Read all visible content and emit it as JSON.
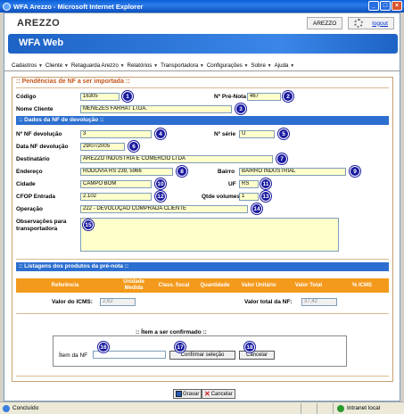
{
  "window": {
    "title": "WFA Arezzo - Microsoft Internet Explorer"
  },
  "header": {
    "brand": "AREZZO",
    "user_box": "AREZZO",
    "logout": "logout"
  },
  "banner": {
    "title": "WFA Web"
  },
  "menu": [
    "Cadastros",
    "Cliente",
    "Retaguarda Arezzo",
    "Relatórios",
    "Transportadora",
    "Configurações",
    "Sobre",
    "Ajuda"
  ],
  "panel": {
    "title": ":: Pendências de NF a ser importada ::",
    "codigo": {
      "label": "Código",
      "value": "16305"
    },
    "pre_nota": {
      "label": "Nº Pré-Nota",
      "value": "467"
    },
    "nome_cliente": {
      "label": "Nome Cliente",
      "value": "MENEZES FARHAT LTDA."
    },
    "section_devolucao": ":: Dados da NF de devolução ::",
    "nf_devolucao": {
      "label": "Nº NF devolução",
      "value": "3"
    },
    "serie": {
      "label": "Nº série",
      "value": "U"
    },
    "data_nf": {
      "label": "Data NF devolução",
      "value": "29/07/2005"
    },
    "destinatario": {
      "label": "Destinatário",
      "value": "AREZZO INDUSTRIA E COMÉRCIO LTDA"
    },
    "endereco": {
      "label": "Endereço",
      "value": "RODOVIA RS 239, 5966"
    },
    "bairro": {
      "label": "Bairro",
      "value": "BAIRRO INDUSTRIAL"
    },
    "cidade": {
      "label": "Cidade",
      "value": "CAMPO BOM"
    },
    "uf": {
      "label": "UF",
      "value": "RS"
    },
    "cfop": {
      "label": "CFOP Entrada",
      "value": "2.102"
    },
    "volumes": {
      "label": "Qtde volumes",
      "value": "1"
    },
    "operacao": {
      "label": "Operação",
      "value": "222 - DEVOLUÇÃO COMPRADA CLIENTE"
    },
    "observacoes": {
      "label_line1": "Observações para",
      "label_line2": "transportadora",
      "value": ""
    },
    "section_produtos": ":: Listagens dos produtos da pré-nota ::",
    "grid_columns": [
      "Referência",
      "Unidade Medida",
      "Class. fiscal",
      "Quantidade",
      "Valor Unitário",
      "Valor Total",
      "% ICMS"
    ],
    "valor_icms": {
      "label": "Valor do ICMS:",
      "value": "2,62"
    },
    "valor_total_nf": {
      "label": "Valor total da NF:",
      "value": "37,42"
    },
    "confirm": {
      "title": ":: Ítem a ser confirmado ::",
      "item_label": "Ítem da NF",
      "item_value": "",
      "confirm_button": "Confirmar seleção",
      "cancel_button": "Cancelar"
    },
    "save_button": "Gravar",
    "cancel_button": "Cancelar"
  },
  "badges": [
    "1",
    "2",
    "3",
    "4",
    "5",
    "6",
    "7",
    "8",
    "9",
    "10",
    "11",
    "12",
    "13",
    "14",
    "15",
    "16",
    "17",
    "18"
  ],
  "status": {
    "left": "Concluído",
    "zone": "Intranet local"
  },
  "colors": {
    "accent_blue": "#2d6fd0",
    "grid_orange": "#f39a1c",
    "field_yellow": "#ffffcc",
    "title_orange": "#c4561a",
    "badge_navy": "#1a1aa0"
  }
}
